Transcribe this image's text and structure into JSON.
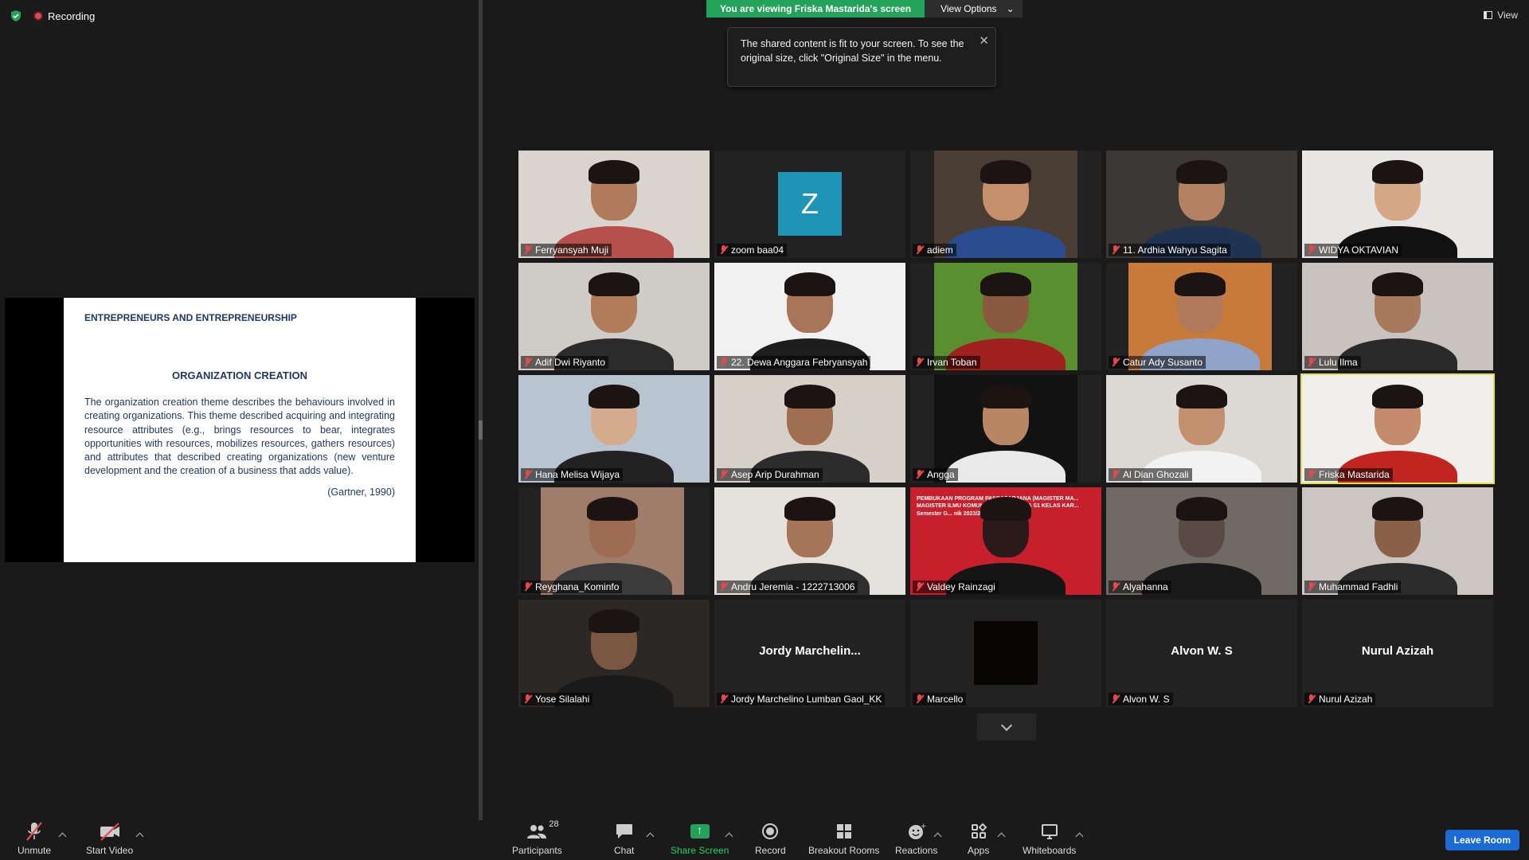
{
  "status": {
    "recording_label": "Recording"
  },
  "banner": {
    "viewing_text": "You are viewing Friska Mastarida's screen",
    "view_options_label": "View Options"
  },
  "tooltip": {
    "text": "The shared content is fit to your screen. To see the original size, click \"Original Size\" in the menu."
  },
  "view_label": "View",
  "slide": {
    "heading": "ENTREPRENEURS AND ENTREPRENEURSHIP",
    "subheading": "ORGANIZATION CREATION",
    "body": "The organization creation theme describes the behaviours involved in creating organizations. This theme described acquiring and integrating resource attributes (e.g., brings resources to bear, integrates opportunities with resources, mobilizes resources, gathers resources) and attributes that described creating organizations (new venture development and the creation of a business that adds value).",
    "citation": "(Gartner, 1990)"
  },
  "participants": [
    {
      "name": "Ferryansyah Muji",
      "bg": "#d9d4ce",
      "skin": "#b07b5a",
      "shirt": "#b6504a"
    },
    {
      "name": "zoom baa04",
      "avatar_letter": "Z",
      "avatar_color": "#1e94b6"
    },
    {
      "name": "adiem",
      "bg": "#4a3e34",
      "skin": "#c58f6b",
      "shirt": "#2b4c8e"
    },
    {
      "name": "11. Ardhia Wahyu Sagita",
      "bg": "#3b3836",
      "skin": "#b58163",
      "shirt": "#1f3354"
    },
    {
      "name": "WIDYA OKTAVIAN",
      "bg": "#e8e6e4",
      "skin": "#d4a886",
      "shirt": "#111111"
    },
    {
      "name": "Adif Dwi Riyanto",
      "bg": "#cfcbc7",
      "skin": "#b27c5b",
      "shirt": "#2b2b2b"
    },
    {
      "name": "22. Dewa Anggara Febryansyah",
      "bg": "#f1f1f1",
      "skin": "#a8755a",
      "shirt": "#1d1d1d"
    },
    {
      "name": "Irvan Toban",
      "bg": "#5a8f2f",
      "skin": "#8a5a40",
      "shirt": "#a02020"
    },
    {
      "name": "Catur Ady Susanto",
      "bg": "#c87a3a",
      "skin": "#b07a5a",
      "shirt": "#8fa4c8"
    },
    {
      "name": "Lulu Ilma",
      "bg": "#c8c3bf",
      "skin": "#a77a5e",
      "shirt": "#2a2a2a"
    },
    {
      "name": "Hana Melisa Wijaya",
      "bg": "#b9c4d1",
      "skin": "#d5ab8e",
      "shirt": "#222222"
    },
    {
      "name": "Asep Arip Durahman",
      "bg": "#d6d0c9",
      "skin": "#a06f52",
      "shirt": "#2c2c2c"
    },
    {
      "name": "Angga",
      "bg": "#121212",
      "skin": "#b98664",
      "shirt": "#e9e9e9"
    },
    {
      "name": "Al Dian Ghozali",
      "bg": "#dcd9d5",
      "skin": "#c3906e",
      "shirt": "#f2f2f2"
    },
    {
      "name": "Friska Mastarida",
      "bg": "#f1efec",
      "skin": "#c48c6c",
      "shirt": "#c0261f"
    },
    {
      "name": "Reyghana_Kominfo",
      "bg": "#a07c6a",
      "skin": "#9e6c52",
      "shirt": "#3b3b3b"
    },
    {
      "name": "Andru Jeremia - 1222713006",
      "bg": "#e5e1dc",
      "skin": "#a67558",
      "shirt": "#2f2f2f"
    },
    {
      "name": "Valdey Rainzagi",
      "bg": "#c71f2c",
      "skin": "#2a1a1a",
      "shirt": "#151515",
      "banner_text": "PEMBUKAAN PROGRAM PASCASARJANA (MAGISTER MA... MAGISTER ILMU KOMUNIKASI... SARJANA S1 KELAS KAR... Semester G... nik 2023/2024"
    },
    {
      "name": "Alyahanna",
      "bg": "#6f6a66",
      "skin": "#5a4a44",
      "shirt": "#1a1a1a"
    },
    {
      "name": "Muhammad Fadhli",
      "bg": "#cbc6c1",
      "skin": "#8a6048",
      "shirt": "#2b2b2b"
    },
    {
      "name": "Yose Silalahi",
      "bg": "#2c2826",
      "skin": "#7b5640",
      "shirt": "#1a1a1a"
    },
    {
      "name": "Jordy Marchelino Lumban Gaol_KK",
      "display_name": "Jordy  Marchelin..."
    },
    {
      "name": "Marcello",
      "black_box": true
    },
    {
      "name": "Alvon W. S",
      "display_name": "Alvon W. S"
    },
    {
      "name": "Nurul Azizah",
      "display_name": "Nurul Azizah"
    }
  ],
  "toolbar": {
    "unmute": "Unmute",
    "start_video": "Start Video",
    "participants": "Participants",
    "participants_count": "28",
    "chat": "Chat",
    "share_screen": "Share Screen",
    "record": "Record",
    "breakout_rooms": "Breakout Rooms",
    "reactions": "Reactions",
    "apps": "Apps",
    "whiteboards": "Whiteboards",
    "leave_room": "Leave Room"
  }
}
